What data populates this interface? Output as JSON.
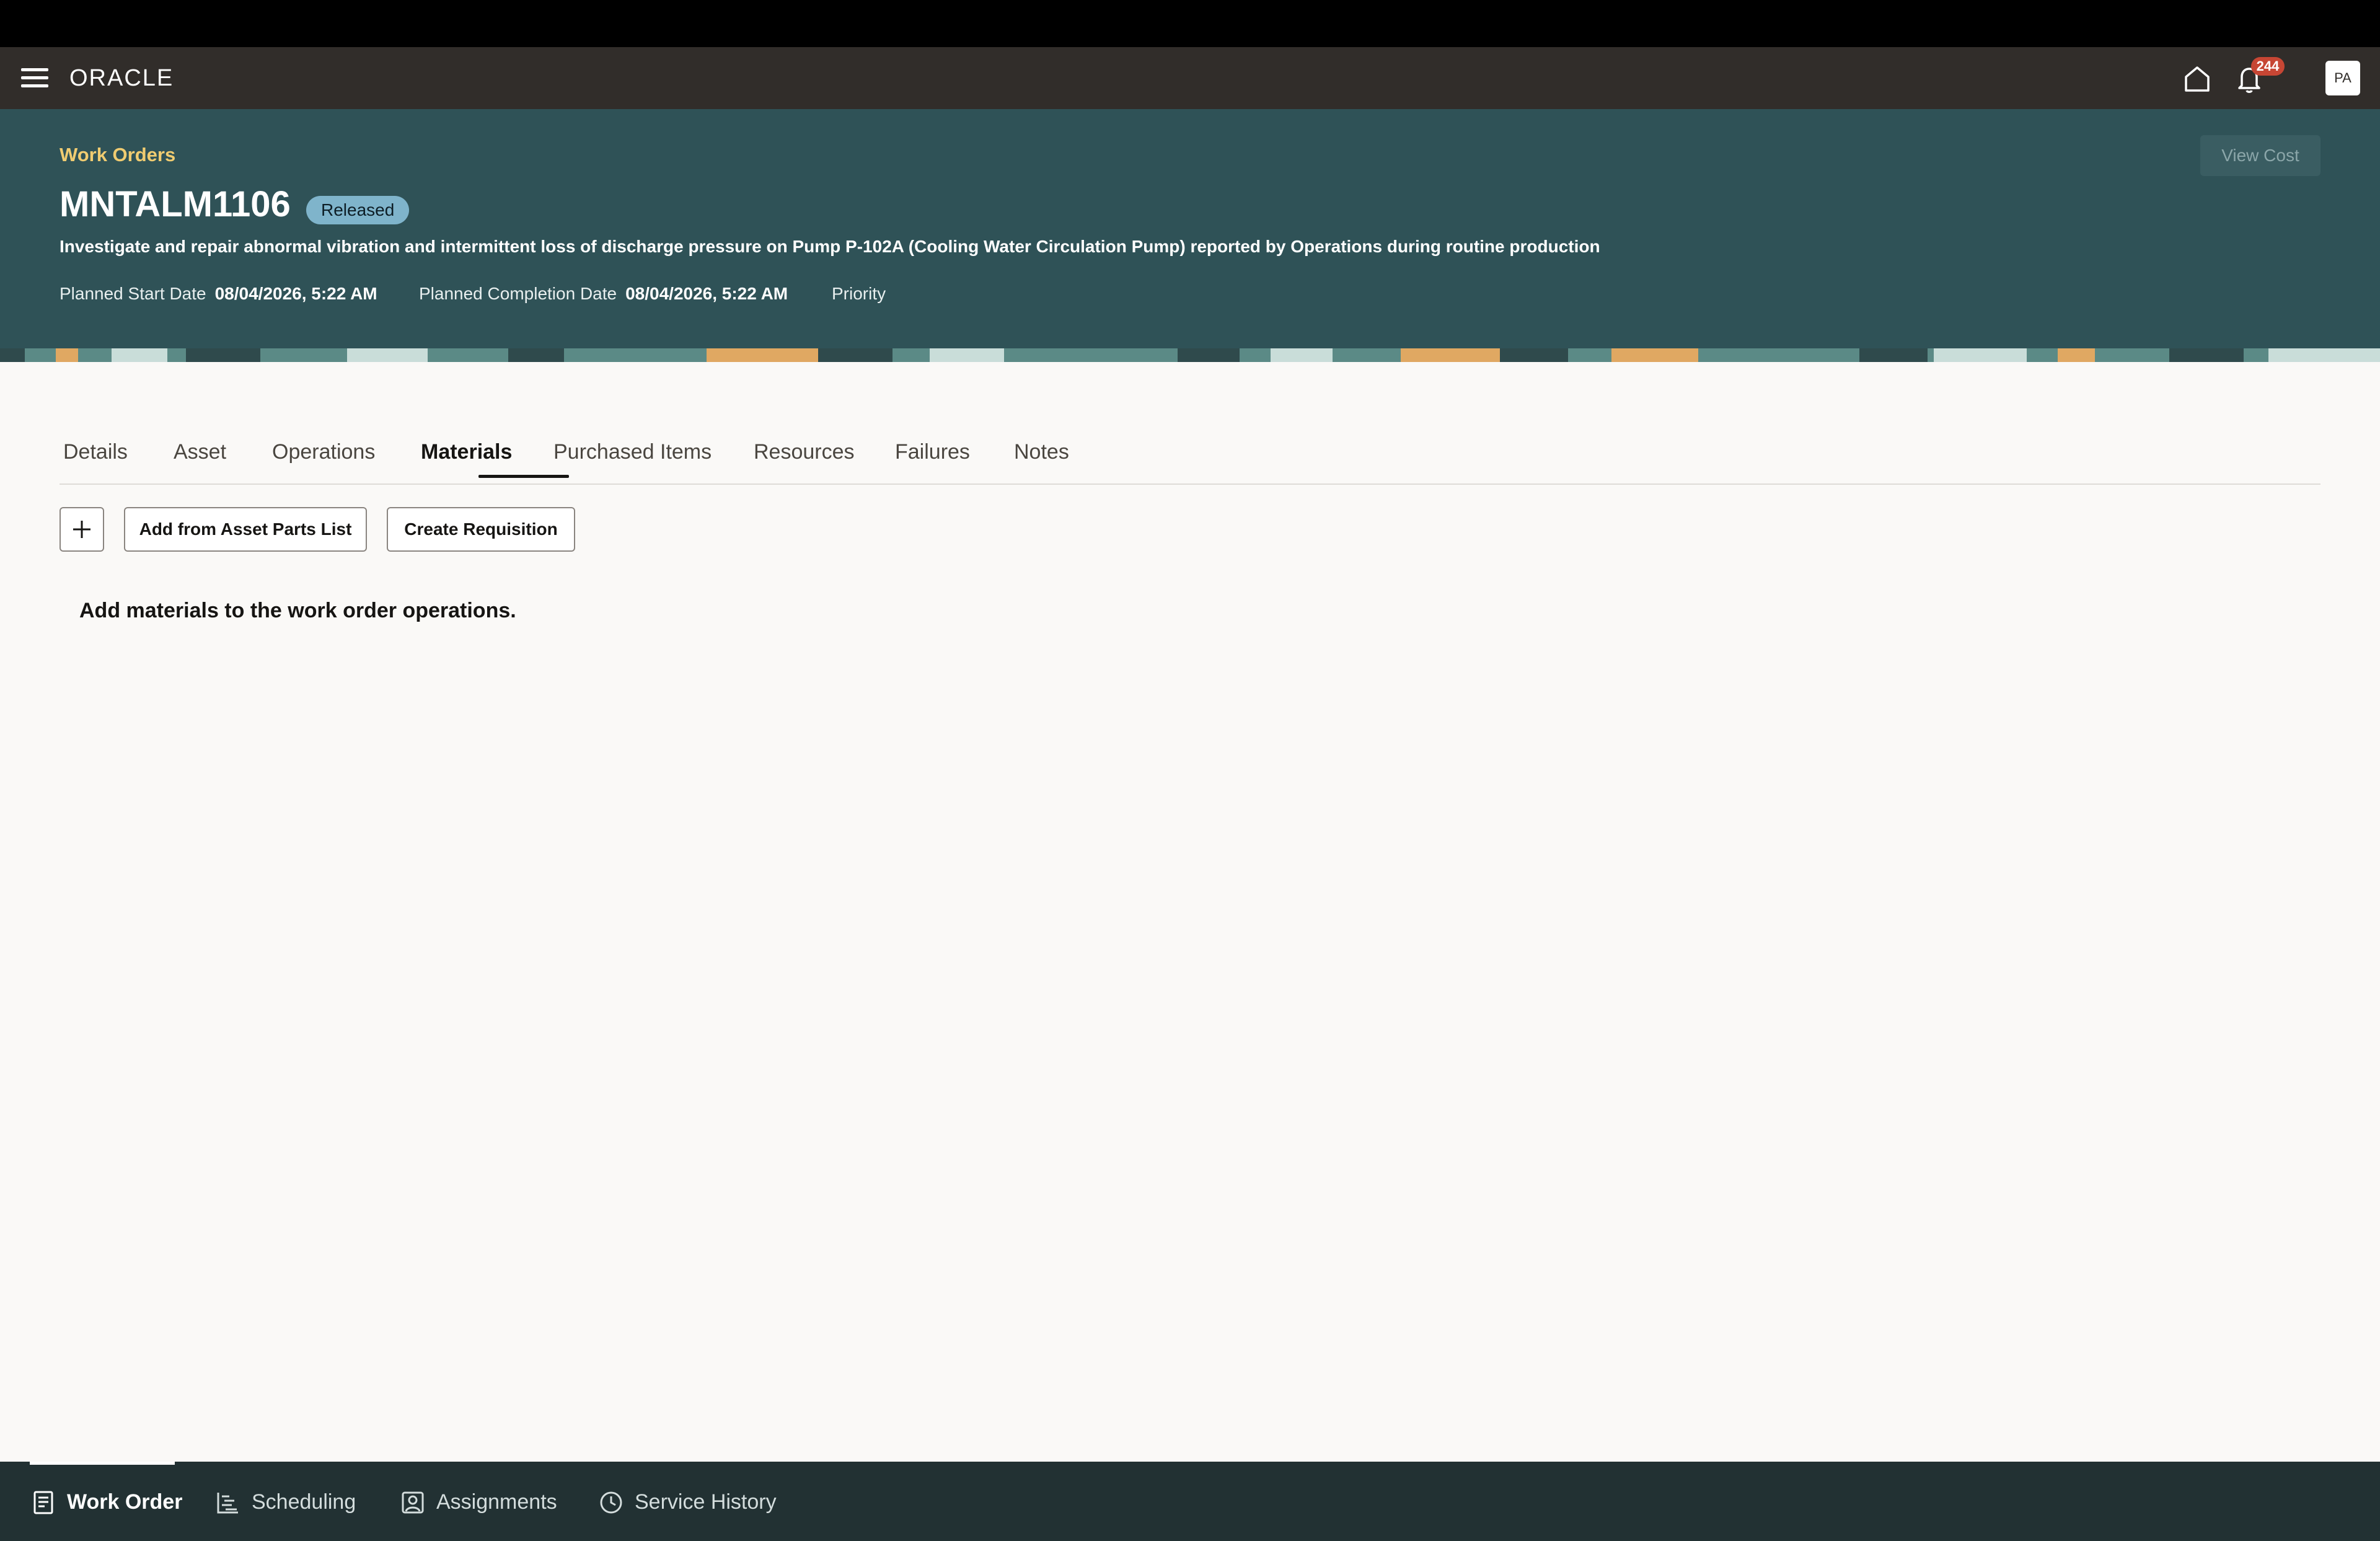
{
  "header": {
    "logo_text": "ORACLE",
    "notification_count": "244",
    "avatar_initials": "PA"
  },
  "hero": {
    "breadcrumb": "Work Orders",
    "view_cost_label": "View Cost",
    "work_order_number": "MNTALM1106",
    "status": "Released",
    "description": "Investigate and repair abnormal vibration and intermittent loss of discharge pressure on Pump P-102A (Cooling Water Circulation Pump) reported by Operations during routine production",
    "planned_start_label": "Planned Start Date",
    "planned_start_value": "08/04/2026, 5:22 AM",
    "planned_completion_label": "Planned Completion Date",
    "planned_completion_value": "08/04/2026, 5:22 AM",
    "priority_label": "Priority"
  },
  "tabs": [
    {
      "label": "Details"
    },
    {
      "label": "Asset"
    },
    {
      "label": "Operations"
    },
    {
      "label": "Materials"
    },
    {
      "label": "Purchased Items"
    },
    {
      "label": "Resources"
    },
    {
      "label": "Failures"
    },
    {
      "label": "Notes"
    }
  ],
  "toolbar": {
    "add_from_parts_label": "Add from Asset Parts List",
    "create_requisition_label": "Create Requisition"
  },
  "content": {
    "empty_message": "Add materials to the work order operations."
  },
  "bottom_nav": [
    {
      "label": "Work Order",
      "icon": "document-icon"
    },
    {
      "label": "Scheduling",
      "icon": "gantt-icon"
    },
    {
      "label": "Assignments",
      "icon": "person-icon"
    },
    {
      "label": "Service History",
      "icon": "clock-icon"
    }
  ],
  "colors": {
    "app_bar": "#312d2a",
    "hero_bg": "#2f5257",
    "breadcrumb": "#f0cc71",
    "status_badge": "#7fb4cb",
    "notification_badge": "#c74634",
    "bottom_nav": "#223133"
  }
}
